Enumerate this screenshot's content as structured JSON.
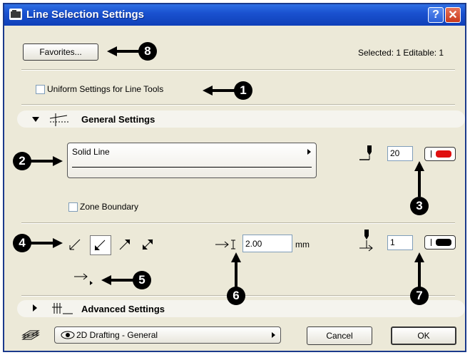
{
  "window": {
    "title": "Line Selection Settings",
    "help_label": "?",
    "close_label": "✕"
  },
  "top": {
    "favorites_label": "Favorites...",
    "selection_status": "Selected: 1 Editable: 1"
  },
  "uniform": {
    "label": "Uniform Settings for Line Tools",
    "checked": false
  },
  "general": {
    "header": "General Settings",
    "line_type": "Solid Line",
    "pen_number": "20",
    "pen_color": "#e01010",
    "zone_boundary_label": "Zone Boundary",
    "zone_boundary_checked": false,
    "arrowhead_size": "2.00",
    "arrowhead_unit": "mm",
    "arrowhead_pen": "1",
    "arrowhead_pen_color": "#000000"
  },
  "advanced": {
    "header": "Advanced Settings"
  },
  "bottom": {
    "layer_value": "2D Drafting - General",
    "cancel_label": "Cancel",
    "ok_label": "OK"
  },
  "callouts": [
    "1",
    "2",
    "3",
    "4",
    "5",
    "6",
    "7",
    "8"
  ]
}
